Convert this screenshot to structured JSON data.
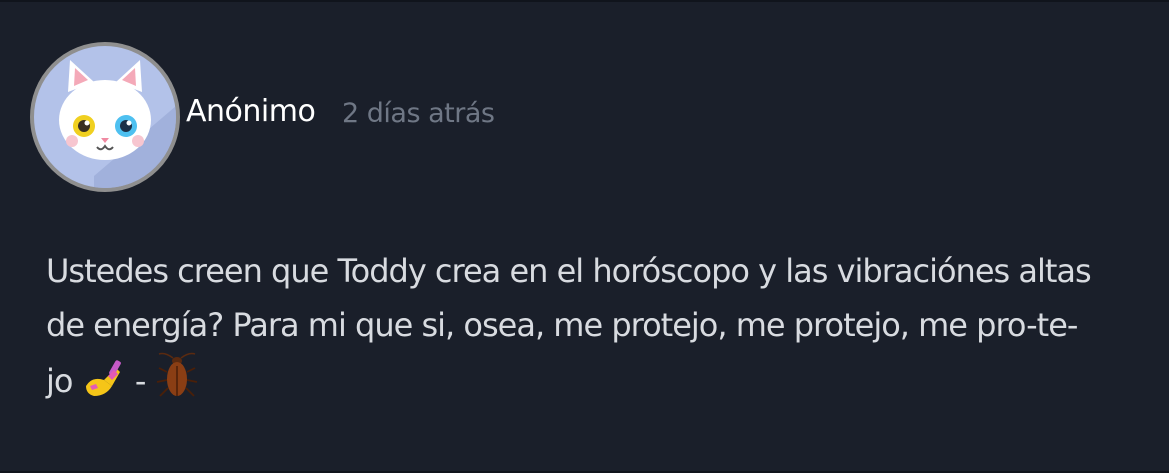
{
  "post": {
    "author": "Anónimo",
    "timestamp": "2 días atrás",
    "avatar_icon": "white-cat-icon",
    "body_lines": [
      "Ustedes creen que Toddy crea en el horóscopo y las vibraciónes altas",
      "de energía? Para mi que si, osea, me protejo, me protejo, me pro-te-",
      "jo",
      "-"
    ],
    "emojis": [
      "nail-polish-emoji",
      "cockroach-emoji"
    ]
  },
  "colors": {
    "background": "#1a1f2a",
    "author_text": "#ffffff",
    "timestamp_text": "#6f7785",
    "body_text": "#d8dbe0",
    "avatar_bg": "#b3c2e9",
    "avatar_border": "#8f8f8f"
  }
}
